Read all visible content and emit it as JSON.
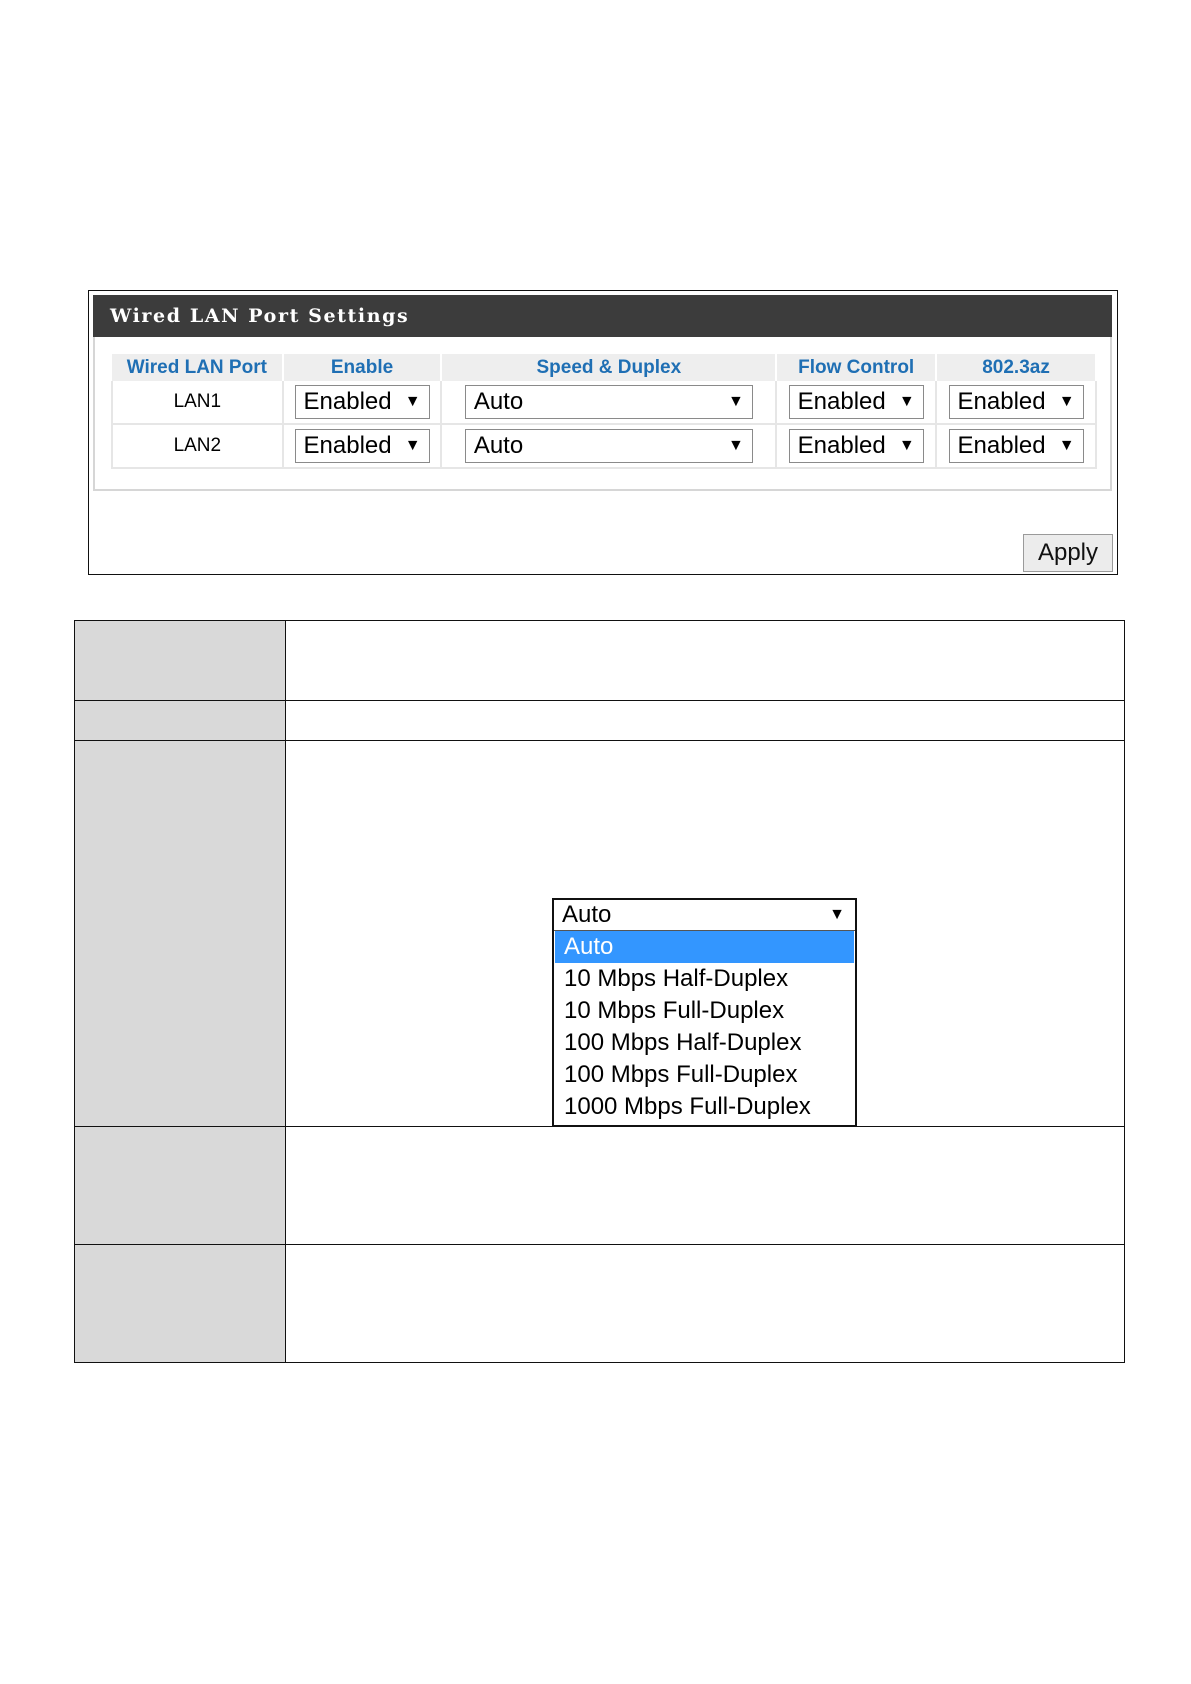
{
  "panel": {
    "title": "Wired LAN Port Settings",
    "columns": [
      "Wired LAN Port",
      "Enable",
      "Speed & Duplex",
      "Flow Control",
      "802.3az"
    ],
    "rows": [
      {
        "port": "LAN1",
        "enable": "Enabled",
        "speed": "Auto",
        "flow": "Enabled",
        "eee": "Enabled"
      },
      {
        "port": "LAN2",
        "enable": "Enabled",
        "speed": "Auto",
        "flow": "Enabled",
        "eee": "Enabled"
      }
    ],
    "apply_label": "Apply",
    "arrow_glyph": "▼"
  },
  "dropdown": {
    "current": "Auto",
    "arrow_glyph": "▼",
    "options": [
      "Auto",
      "10 Mbps Half-Duplex",
      "10 Mbps Full-Duplex",
      "100 Mbps Half-Duplex",
      "100 Mbps Full-Duplex",
      "1000 Mbps Full-Duplex"
    ],
    "highlight_color": "#3396ff"
  },
  "colors": {
    "header_bg": "#3c3c3c",
    "column_header_text": "#1f6fb4",
    "label_cell_bg": "#d9d9d9"
  }
}
